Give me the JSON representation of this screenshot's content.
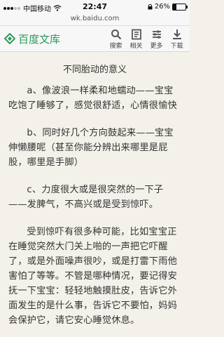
{
  "status": {
    "carrier": "中国移动",
    "time": "22:47",
    "battery": "26%"
  },
  "browser": {
    "url": "wk.baidu.com"
  },
  "header": {
    "app_title": "百度文库",
    "search_label": "搜索",
    "related_label": "相关",
    "more_label": "更多",
    "download_label": "下载"
  },
  "doc": {
    "title": "不同胎动的意义",
    "paragraphs": [
      "a、像波浪一样柔和地蠕动——宝宝吃饱了睡够了，感觉很舒适，心情很愉快",
      "b、同时好几个方向鼓起来——宝宝伸懒腰呢（甚至你能分辨出来哪里是屁股，哪里是手脚）",
      "c、力度很大或是很突然的一下子——发脾气，不高兴或是受到惊吓。",
      "受到惊吓有很多种可能，比如宝宝正在睡觉突然大门关上啪的一声把它吓醒了，或是外面噪声很吵，或是打雷下雨他害怕了等等。不管是哪种情况，要记得安抚一下宝宝：轻轻地触摸肚皮，告诉它外面发生的是什么事，告诉它不要怕，妈妈会保护它，请它安心睡觉休息。"
    ]
  },
  "colors": {
    "brand": "#2d9a58",
    "background": "#f3f1ea"
  },
  "icons": [
    "signal-icon",
    "wifi-icon",
    "lock-icon",
    "battery-icon",
    "logo-icon",
    "search-icon",
    "related-icon",
    "more-icon",
    "download-icon"
  ]
}
